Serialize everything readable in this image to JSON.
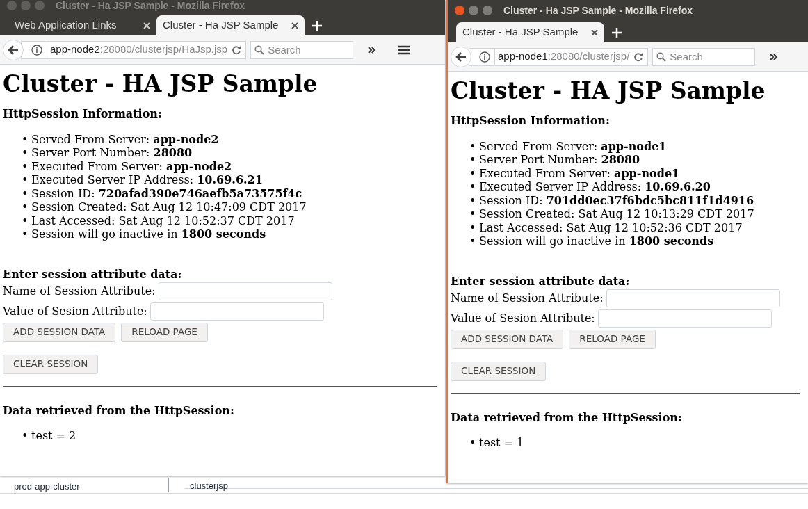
{
  "background_window": {
    "tree_item": "prod-app-cluster",
    "cells": [
      "clusterjsp"
    ]
  },
  "windows": [
    {
      "title": "Cluster - Ha JSP Sample - Mozilla Firefox",
      "active": false,
      "tabs": [
        {
          "label": "Web Application Links",
          "selected": false
        },
        {
          "label": "Cluster - Ha JSP Sample",
          "selected": true
        }
      ],
      "url_host": "app-node2",
      "url_rest": ":28080/clusterjsp/HaJsp.jsp",
      "search_placeholder": "Search",
      "menu_button": true,
      "page": {
        "heading": "Cluster - HA JSP Sample",
        "info_heading": "HttpSession Information:",
        "info": [
          {
            "marker": "•",
            "text": "Served From Server: **app-node2**"
          },
          {
            "marker": "•",
            "text": "Server Port Number: **28080**"
          },
          {
            "marker": "•",
            "text": "Executed From Server: **app-node2**"
          },
          {
            "marker": "•",
            "text": "Executed Server IP Address: **10.69.6.21**"
          },
          {
            "marker": "•",
            "text": "Session ID: **720afad390e746aefb5a73575f4c**"
          },
          {
            "marker": "•",
            "text": "Session Created: Sat Aug 12 10:47:09 CDT 2017"
          },
          {
            "marker": "•",
            "text": "Last Accessed: Sat Aug 12 10:52:37 CDT 2017"
          },
          {
            "marker": "•",
            "text": "Session will go inactive in **1800 seconds**"
          }
        ],
        "form_heading": "Enter session attribute data:",
        "fields": [
          "Name of Session Attribute:",
          "Value of Sesion Attribute:"
        ],
        "button_rows": [
          [
            "ADD SESSION DATA",
            "RELOAD PAGE"
          ],
          [
            "CLEAR SESSION"
          ]
        ],
        "data_heading": "Data retrieved from the HttpSession:",
        "data_items": [
          {
            "marker": "•",
            "text": "test = 2"
          }
        ]
      }
    },
    {
      "title": "Cluster - Ha JSP Sample - Mozilla Firefox",
      "active": true,
      "tabs": [
        {
          "label": "Cluster - Ha JSP Sample",
          "selected": true
        }
      ],
      "url_host": "app-node1",
      "url_rest": ":28080/clusterjsp/",
      "search_placeholder": "Search",
      "menu_button": false,
      "page": {
        "heading": "Cluster - HA JSP Sample",
        "info_heading": "HttpSession Information:",
        "info": [
          {
            "marker": "•",
            "text": "Served From Server: **app-node1**"
          },
          {
            "marker": "•",
            "text": "Server Port Number: **28080**"
          },
          {
            "marker": "•",
            "text": "Executed From Server: **app-node1**"
          },
          {
            "marker": "•",
            "text": "Executed Server IP Address: **10.69.6.20**"
          },
          {
            "marker": "•",
            "text": "Session ID: **701dd0ec37f6bdc5bc811f1d4916**"
          },
          {
            "marker": "•",
            "text": "Session Created: Sat Aug 12 10:13:29 CDT 2017"
          },
          {
            "marker": "•",
            "text": "Last Accessed: Sat Aug 12 10:52:36 CDT 2017"
          },
          {
            "marker": "•",
            "text": "Session will go inactive in **1800 seconds**"
          }
        ],
        "form_heading": "Enter session attribute data:",
        "fields": [
          "Name of Session Attribute:",
          "Value of Sesion Attribute:"
        ],
        "button_rows": [
          [
            "ADD SESSION DATA",
            "RELOAD PAGE"
          ],
          [
            "CLEAR SESSION"
          ]
        ],
        "data_heading": "Data retrieved from the HttpSession:",
        "data_items": [
          {
            "marker": "•",
            "text": "test = 1"
          }
        ]
      }
    }
  ]
}
